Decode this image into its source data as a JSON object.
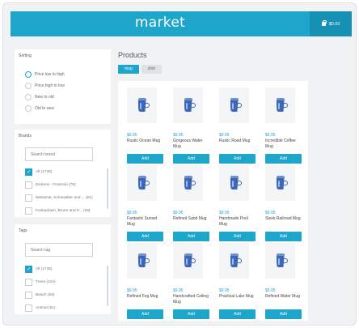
{
  "header": {
    "brand": "market",
    "cart_total": "$0.00"
  },
  "sorting": {
    "title": "Sorting",
    "options": [
      {
        "label": "Price low to high",
        "selected": true
      },
      {
        "label": "Price high to low",
        "selected": false
      },
      {
        "label": "New to old",
        "selected": false
      },
      {
        "label": "Old to new",
        "selected": false
      }
    ]
  },
  "brands": {
    "title": "Brands",
    "search_placeholder": "Search brand",
    "items": [
      {
        "label": "All (1745)",
        "checked": true
      },
      {
        "label": "Dickens - Franecki (75)",
        "checked": false
      },
      {
        "label": "Weissnat, Schowalter and ... (51)",
        "checked": false
      },
      {
        "label": "Funkadown, Bruen and P... (29)",
        "checked": false
      }
    ]
  },
  "tags": {
    "title": "Tags",
    "search_placeholder": "Search tag",
    "items": [
      {
        "label": "All (1745)",
        "checked": true
      },
      {
        "label": "Trees (210)",
        "checked": false
      },
      {
        "label": "Beach (69)",
        "checked": false
      },
      {
        "label": "Animal (51)",
        "checked": false
      }
    ]
  },
  "products": {
    "title": "Products",
    "tabs": [
      {
        "label": "mug",
        "active": true
      },
      {
        "label": "shirt",
        "active": false
      }
    ],
    "add_label": "Add",
    "items": [
      {
        "price": "$9.95",
        "name": "Rustic Ocean Mug"
      },
      {
        "price": "$9.95",
        "name": "Gorgeous Water Mug"
      },
      {
        "price": "$9.95",
        "name": "Rustic Road Mug"
      },
      {
        "price": "$9.95",
        "name": "Incredible Coffee Mug"
      },
      {
        "price": "$9.95",
        "name": "Fantastic Sunset Mug"
      },
      {
        "price": "$9.95",
        "name": "Refined Sand Mug"
      },
      {
        "price": "$9.95",
        "name": "Handmade Pool Mug"
      },
      {
        "price": "$9.95",
        "name": "Sleek Railroad Mug"
      },
      {
        "price": "$9.95",
        "name": "Refined Fog Mug"
      },
      {
        "price": "$9.95",
        "name": "Handcrafted Ceiling Mug"
      },
      {
        "price": "$9.95",
        "name": "Practical Lake Mug"
      },
      {
        "price": "$9.95",
        "name": "Refined Water Mug"
      }
    ]
  },
  "icons": {
    "cart": "shopping-bag-icon",
    "product_image": "mug-icon"
  },
  "colors": {
    "accent": "#1ea5cc",
    "accent_dark": "#1690b3",
    "background": "#f1f2f4"
  }
}
